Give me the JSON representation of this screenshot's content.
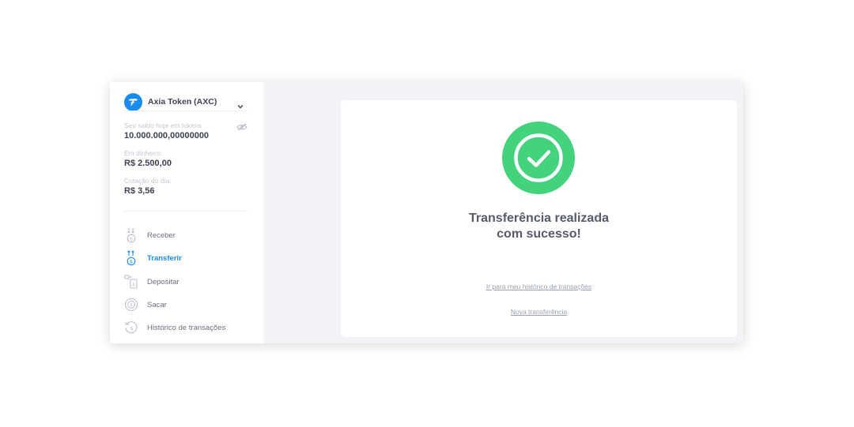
{
  "token": {
    "name": "Axia Token (AXC)",
    "icon": "axia-logo-icon",
    "accent": "#1a8cf0"
  },
  "balances": {
    "tokens_label": "Seu saldo hoje em tokens",
    "tokens_value": "10.000.000,00000000",
    "cash_label": "Em dinheiro:",
    "cash_value": "R$ 2.500,00",
    "rate_label": "Cotação do dia:",
    "rate_value": "R$ 3,56"
  },
  "nav": {
    "items": [
      {
        "label": "Receber",
        "icon": "receive-icon",
        "active": false
      },
      {
        "label": "Transferir",
        "icon": "transfer-icon",
        "active": true
      },
      {
        "label": "Depositar",
        "icon": "deposit-icon",
        "active": false
      },
      {
        "label": "Sacar",
        "icon": "withdraw-icon",
        "active": false
      },
      {
        "label": "Histórico de transações",
        "icon": "history-icon",
        "active": false
      }
    ]
  },
  "result": {
    "title": "Transferência realizada com sucesso!",
    "history_link": "Ir para meu histórico de transações",
    "new_link": "Nova transferência",
    "success_color": "#43d37c"
  }
}
